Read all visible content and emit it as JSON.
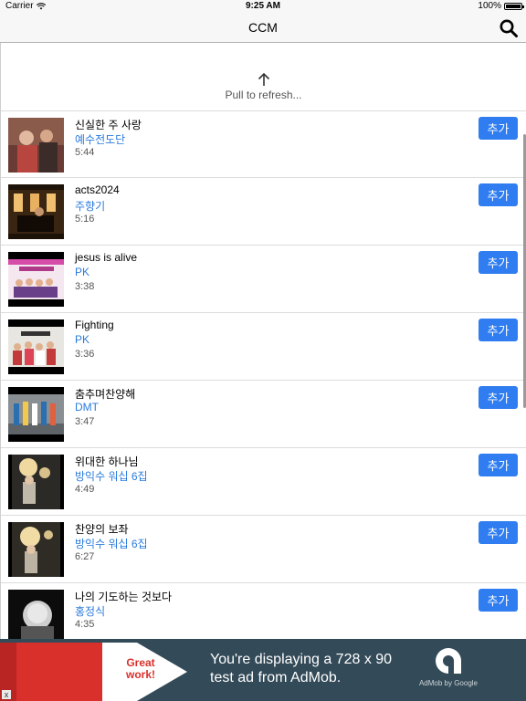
{
  "status_bar": {
    "carrier": "Carrier",
    "time": "9:25 AM",
    "battery": "100%"
  },
  "nav": {
    "title": "CCM"
  },
  "refresh": {
    "label": "Pull to refresh..."
  },
  "songs": [
    {
      "title": "신실한 주 사랑",
      "artist": "예수전도단",
      "duration": "5:44",
      "add_label": "추가"
    },
    {
      "title": "acts2024",
      "artist": "주향기",
      "duration": "5:16",
      "add_label": "추가"
    },
    {
      "title": "jesus is alive",
      "artist": "PK",
      "duration": "3:38",
      "add_label": "추가"
    },
    {
      "title": "Fighting",
      "artist": "PK",
      "duration": "3:36",
      "add_label": "추가"
    },
    {
      "title": "춤추며찬양해",
      "artist": "DMT",
      "duration": "3:47",
      "add_label": "추가"
    },
    {
      "title": "위대한 하나님",
      "artist": "방익수 워십 6집",
      "duration": "4:49",
      "add_label": "추가"
    },
    {
      "title": "찬양의 보좌",
      "artist": "방익수 워십 6집",
      "duration": "6:27",
      "add_label": "추가"
    },
    {
      "title": "나의 기도하는 것보다",
      "artist": "홍정식",
      "duration": "4:35",
      "add_label": "추가"
    }
  ],
  "ad": {
    "badge": [
      "Great",
      "work!"
    ],
    "line1": "You're displaying a 728 x 90",
    "line2": "test ad from AdMob.",
    "logo_caption": "AdMob by Google",
    "close": "x"
  },
  "colors": {
    "accent": "#2f7df0",
    "link": "#2a7bde",
    "ad_bg": "#334a58",
    "ad_red": "#d9302c"
  },
  "icons": {
    "search": "search-icon",
    "refresh_arrow": "arrow-up-icon",
    "wifi": "wifi-icon",
    "battery": "battery-icon"
  }
}
